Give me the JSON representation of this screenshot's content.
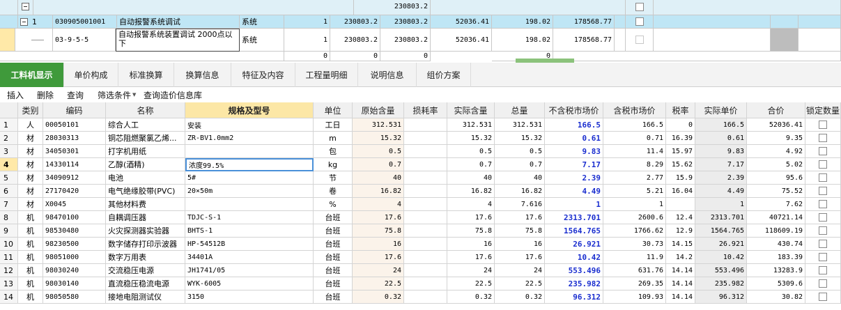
{
  "top_grid": {
    "row0": {
      "amount": "230803.2"
    },
    "row1": {
      "seq": "1",
      "code": "030905001001",
      "name": "自动报警系统调试",
      "unit": "系统",
      "qty": "1",
      "price1": "230803.2",
      "price2": "230803.2",
      "labor": "52036.41",
      "material": "198.02",
      "machine": "178568.77"
    },
    "row2": {
      "code": "03-9-5-5",
      "name": "自动报警系统装置调试 2000点以下",
      "unit": "系统",
      "qty": "1",
      "price1": "230803.2",
      "price2": "230803.2",
      "labor": "52036.41",
      "material": "198.02",
      "machine": "178568.77"
    },
    "row3": {
      "c1": "0",
      "c2": "0",
      "c3": "0",
      "c4": "0"
    }
  },
  "tabs": [
    "工料机显示",
    "单价构成",
    "标准换算",
    "换算信息",
    "特征及内容",
    "工程量明细",
    "说明信息",
    "组价方案"
  ],
  "toolbar": {
    "insert": "插入",
    "delete": "删除",
    "query": "查询",
    "filter": "筛选条件",
    "query_price_db": "查询造价信息库"
  },
  "columns": [
    "类别",
    "编码",
    "名称",
    "规格及型号",
    "单位",
    "原始含量",
    "损耗率",
    "实际含量",
    "总量",
    "不含税市场价",
    "含税市场价",
    "税率",
    "实际单价",
    "合价",
    "锁定数量"
  ],
  "rows": [
    {
      "n": "1",
      "type": "人",
      "code": "00050101",
      "name": "综合人工",
      "spec": "安装",
      "unit": "工日",
      "orig": "312.531",
      "loss": "",
      "actual": "312.531",
      "total": "312.531",
      "price": "166.5",
      "taxprice": "166.5",
      "rate": "0",
      "unitp": "166.5",
      "sum": "52036.41"
    },
    {
      "n": "2",
      "type": "材",
      "code": "28030313",
      "name": "铜芯阻燃聚氯乙烯...",
      "spec": "ZR-BV1.0mm2",
      "unit": "m",
      "orig": "15.32",
      "loss": "",
      "actual": "15.32",
      "total": "15.32",
      "price": "0.61",
      "taxprice": "0.71",
      "rate": "16.39",
      "unitp": "0.61",
      "sum": "9.35"
    },
    {
      "n": "3",
      "type": "材",
      "code": "34050301",
      "name": "打字机用纸",
      "spec": "",
      "unit": "包",
      "orig": "0.5",
      "loss": "",
      "actual": "0.5",
      "total": "0.5",
      "price": "9.83",
      "taxprice": "11.4",
      "rate": "15.97",
      "unitp": "9.83",
      "sum": "4.92"
    },
    {
      "n": "4",
      "type": "材",
      "code": "14330114",
      "name": "乙醇(酒精)",
      "spec": "浓度99.5%",
      "unit": "kg",
      "orig": "0.7",
      "loss": "",
      "actual": "0.7",
      "total": "0.7",
      "price": "7.17",
      "taxprice": "8.29",
      "rate": "15.62",
      "unitp": "7.17",
      "sum": "5.02"
    },
    {
      "n": "5",
      "type": "材",
      "code": "34090912",
      "name": "电池",
      "spec": "5#",
      "unit": "节",
      "orig": "40",
      "loss": "",
      "actual": "40",
      "total": "40",
      "price": "2.39",
      "taxprice": "2.77",
      "rate": "15.9",
      "unitp": "2.39",
      "sum": "95.6"
    },
    {
      "n": "6",
      "type": "材",
      "code": "27170420",
      "name": "电气绝缘胶带(PVC)",
      "spec": "20×50m",
      "unit": "卷",
      "orig": "16.82",
      "loss": "",
      "actual": "16.82",
      "total": "16.82",
      "price": "4.49",
      "taxprice": "5.21",
      "rate": "16.04",
      "unitp": "4.49",
      "sum": "75.52"
    },
    {
      "n": "7",
      "type": "材",
      "code": "X0045",
      "name": "其他材料费",
      "spec": "",
      "unit": "%",
      "orig": "4",
      "loss": "",
      "actual": "4",
      "total": "7.616",
      "price": "1",
      "taxprice": "1",
      "rate": "",
      "unitp": "1",
      "sum": "7.62"
    },
    {
      "n": "8",
      "type": "机",
      "code": "98470100",
      "name": "自耦调压器",
      "spec": "TDJC-S-1",
      "unit": "台班",
      "orig": "17.6",
      "loss": "",
      "actual": "17.6",
      "total": "17.6",
      "price": "2313.701",
      "taxprice": "2600.6",
      "rate": "12.4",
      "unitp": "2313.701",
      "sum": "40721.14"
    },
    {
      "n": "9",
      "type": "机",
      "code": "98530480",
      "name": "火灾探测器实验器",
      "spec": "BHTS-1",
      "unit": "台班",
      "orig": "75.8",
      "loss": "",
      "actual": "75.8",
      "total": "75.8",
      "price": "1564.765",
      "taxprice": "1766.62",
      "rate": "12.9",
      "unitp": "1564.765",
      "sum": "118609.19"
    },
    {
      "n": "10",
      "type": "机",
      "code": "98230500",
      "name": "数字储存打印示波器",
      "spec": "HP-54512B",
      "unit": "台班",
      "orig": "16",
      "loss": "",
      "actual": "16",
      "total": "16",
      "price": "26.921",
      "taxprice": "30.73",
      "rate": "14.15",
      "unitp": "26.921",
      "sum": "430.74"
    },
    {
      "n": "11",
      "type": "机",
      "code": "98051000",
      "name": "数字万用表",
      "spec": "34401A",
      "unit": "台班",
      "orig": "17.6",
      "loss": "",
      "actual": "17.6",
      "total": "17.6",
      "price": "10.42",
      "taxprice": "11.9",
      "rate": "14.2",
      "unitp": "10.42",
      "sum": "183.39"
    },
    {
      "n": "12",
      "type": "机",
      "code": "98030240",
      "name": "交流稳压电源",
      "spec": "JH1741/05",
      "unit": "台班",
      "orig": "24",
      "loss": "",
      "actual": "24",
      "total": "24",
      "price": "553.496",
      "taxprice": "631.76",
      "rate": "14.14",
      "unitp": "553.496",
      "sum": "13283.9"
    },
    {
      "n": "13",
      "type": "机",
      "code": "98030140",
      "name": "直流稳压稳流电源",
      "spec": "WYK-6005",
      "unit": "台班",
      "orig": "22.5",
      "loss": "",
      "actual": "22.5",
      "total": "22.5",
      "price": "235.982",
      "taxprice": "269.35",
      "rate": "14.14",
      "unitp": "235.982",
      "sum": "5309.6"
    },
    {
      "n": "14",
      "type": "机",
      "code": "98050580",
      "name": "接地电阻测试仪",
      "spec": "3150",
      "unit": "台班",
      "orig": "0.32",
      "loss": "",
      "actual": "0.32",
      "total": "0.32",
      "price": "96.312",
      "taxprice": "109.93",
      "rate": "14.14",
      "unitp": "96.312",
      "sum": "30.82"
    }
  ],
  "colors": {
    "active_tab": "#3f9a3b",
    "selected_row": "#bfe6f5",
    "market_price_text": "#1a2ecf",
    "highlight_header": "#fce7a6"
  }
}
